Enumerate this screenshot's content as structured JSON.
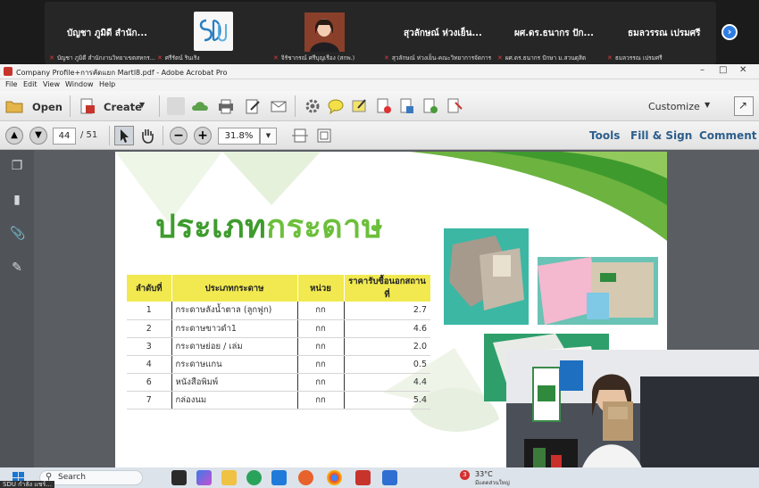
{
  "participants": [
    {
      "name": "บัญชา ภูมิดี สำนัก...",
      "sub": "บัญชา ภูมิดี สำนักงานวิทยาเขตสหกร..."
    },
    {
      "name": "",
      "sub": "ศรีรัตน์ รินเริง"
    },
    {
      "name": "",
      "sub": "จิรัชากรณ์ ศรีบุญเรือง (สกพ.)"
    },
    {
      "name": "สุวลักษณ์ ห่วงเย็น...",
      "sub": "สุวลักษณ์ ห่วงเย็น-คณะวิทยาการจัดการ"
    },
    {
      "name": "ผศ.ดร.ธนากร ปัก...",
      "sub": "ผศ.ดร.ธนากร ปักษา ม.สวนดุสิต"
    },
    {
      "name": "ธมลวรรณ เปรมศรี",
      "sub": "ธมลวรรณ เปรมศรี"
    }
  ],
  "window": {
    "title": "Company Profile+การคัดแยก Martl8.pdf - Adobe Acrobat Pro"
  },
  "menu": [
    "File",
    "Edit",
    "View",
    "Window",
    "Help"
  ],
  "toolbar": {
    "open": "Open",
    "create": "Create",
    "customize": "Customize"
  },
  "nav": {
    "page": "44",
    "total": "/ 51",
    "zoom": "31.8%"
  },
  "links": {
    "tools": "Tools",
    "fill_sign": "Fill & Sign",
    "comment": "Comment"
  },
  "slide": {
    "title_a": "ประเภท",
    "title_b": "กระดาษ",
    "table": {
      "headers": [
        "ลำดับที่",
        "ประเภทกระดาษ",
        "หน่วย",
        "ราคารับซื้อนอกสถานที่"
      ],
      "rows": [
        [
          "1",
          "กระดาษลังน้ำตาล (ลูกฟูก)",
          "กก",
          "2.7"
        ],
        [
          "2",
          "กระดาษขาวดำ1",
          "กก",
          "4.6"
        ],
        [
          "3",
          "กระดาษย่อย / เล่ม",
          "กก",
          "2.0"
        ],
        [
          "4",
          "กระดาษแกน",
          "กก",
          "0.5"
        ],
        [
          "6",
          "หนังสือพิมพ์",
          "กก",
          "4.4"
        ],
        [
          "7",
          "กล่องนม",
          "กก",
          "5.4"
        ]
      ]
    }
  },
  "taskbar": {
    "search": "Search",
    "temp": "33°C",
    "weather_sub": "มีแดดส่วนใหญ่",
    "badge": "3",
    "sharing": "SDU กำลัง แชร์..."
  },
  "colors": {
    "title_dark": "#3e9b2d",
    "title_light": "#6cbf3b",
    "table_header": "#f1e94f",
    "link": "#2d5e8c"
  }
}
